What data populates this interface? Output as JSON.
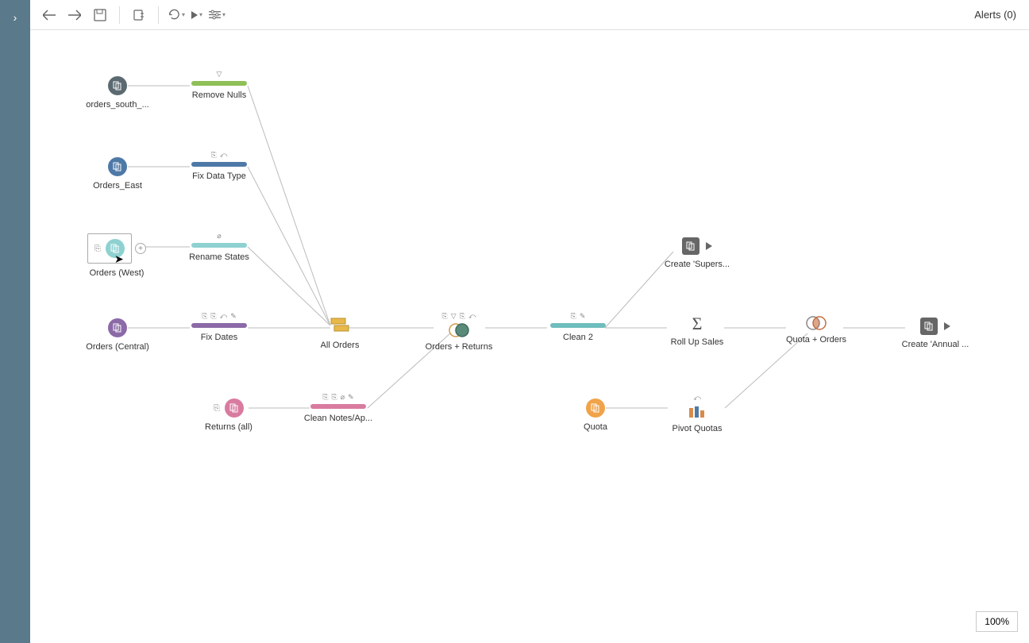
{
  "toolbar": {
    "alerts_label": "Alerts (0)"
  },
  "zoom": "100%",
  "nodes": {
    "orders_south": {
      "label": "orders_south_..."
    },
    "orders_east": {
      "label": "Orders_East"
    },
    "orders_west": {
      "label": "Orders (West)"
    },
    "orders_central": {
      "label": "Orders (Central)"
    },
    "returns_all": {
      "label": "Returns (all)"
    },
    "quota": {
      "label": "Quota"
    },
    "remove_nulls": {
      "label": "Remove Nulls"
    },
    "fix_data_type": {
      "label": "Fix Data Type"
    },
    "rename_states": {
      "label": "Rename States"
    },
    "fix_dates": {
      "label": "Fix Dates"
    },
    "clean_notes": {
      "label": "Clean Notes/Ap..."
    },
    "all_orders": {
      "label": "All Orders"
    },
    "orders_returns": {
      "label": "Orders + Returns"
    },
    "clean_2": {
      "label": "Clean 2"
    },
    "roll_up_sales": {
      "label": "Roll Up Sales"
    },
    "quota_orders": {
      "label": "Quota + Orders"
    },
    "pivot_quotas": {
      "label": "Pivot Quotas"
    },
    "create_supers": {
      "label": "Create 'Supers..."
    },
    "create_annual": {
      "label": "Create 'Annual ..."
    }
  },
  "colors": {
    "green": "#8fbf57",
    "blue": "#4e79a7",
    "teal": "#6fbdbd",
    "purple": "#8b6aa7",
    "pink": "#d97ba0",
    "orange": "#f0a34a",
    "dark": "#5a6a70",
    "light_teal": "#8fd1d1"
  }
}
